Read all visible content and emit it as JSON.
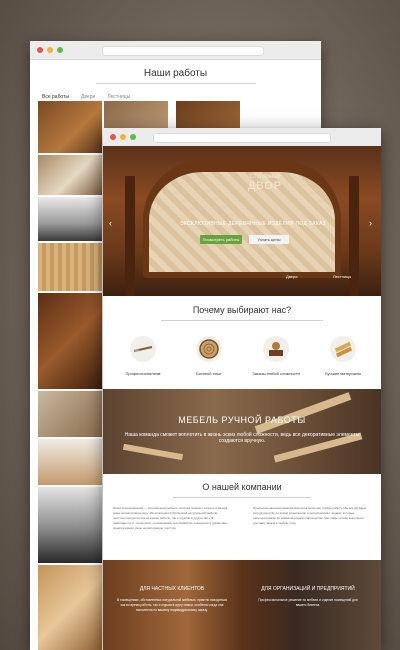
{
  "colors": {
    "accent_green": "#67a43f",
    "wood_dark": "#6a3716",
    "background": "#6e6359"
  },
  "back_page": {
    "title": "Наши работы",
    "tabs": [
      {
        "label": "Все работы",
        "active": true
      },
      {
        "label": "Двери",
        "active": false
      },
      {
        "label": "Лестницы",
        "active": false
      }
    ]
  },
  "hero": {
    "logo_line1": "Столярный",
    "logo_line2": "ДВОР",
    "subtitle": "ЭКСКЛЮЗИВНЫЕ ДЕРЕВЯННЫЕ ИЗДЕЛИЯ ПОД ЗАКАЗ",
    "primary_button": "Посмотреть работы",
    "secondary_button": "Узнать цены",
    "nav_left": "Двери",
    "nav_right": "Лестницы"
  },
  "why": {
    "title": "Почему выбирают нас?",
    "features": [
      {
        "label": "Профессионализм",
        "icon": "chisel-icon"
      },
      {
        "label": "Богатый опыт",
        "icon": "wood-slice-icon"
      },
      {
        "label": "Заказы любой сложности",
        "icon": "lathe-icon"
      },
      {
        "label": "Лучшие материалы",
        "icon": "planks-icon"
      }
    ]
  },
  "craft": {
    "title": "МЕБЕЛЬ РУЧНОЙ РАБОТЫ",
    "subtitle": "Наша команда сможет воплотить в жизнь эскиз любой сложности, ведь все декоративные элементы создаются вручную."
  },
  "about": {
    "title": "О нашей компании",
    "left_text": "Наша специализация — изготовление мебели, которая поможет создать в вашем доме неповторимую ауру. Изготовление собственной натуральной мебели, простые находятся все её время работы, так и отделки в другие квиз. В зависимости от технологии, применяемой при обработке поверхности древесины, изделия имеют свою неповторимую текстуру.",
    "right_text": "Профессиональная команда мастеров выполнит любую работу. Мы всегда рады сотрудничеству со всеми розничными и юридическими лицами, которые заинтересованы во взаимовыгодном партнерстве. Мы также готовы выполнить доставку заказа в любую точку."
  },
  "bottom": {
    "left_title": "ДЛЯ ЧАСТНЫХ КЛИЕНТОВ",
    "left_text": "В помещениях, обставленных натуральной мебелью, приятно находиться как во время работы, так и отдыха в кругу семьи, особенно когда она выполнена по вашему индивидуальному заказу.",
    "right_title": "ДЛЯ ОРГАНИЗАЦИЙ И ПРЕДПРИЯТИЙ",
    "right_text": "Профессиональное решение по мебели и отделке помещений для вашего бизнеса."
  }
}
